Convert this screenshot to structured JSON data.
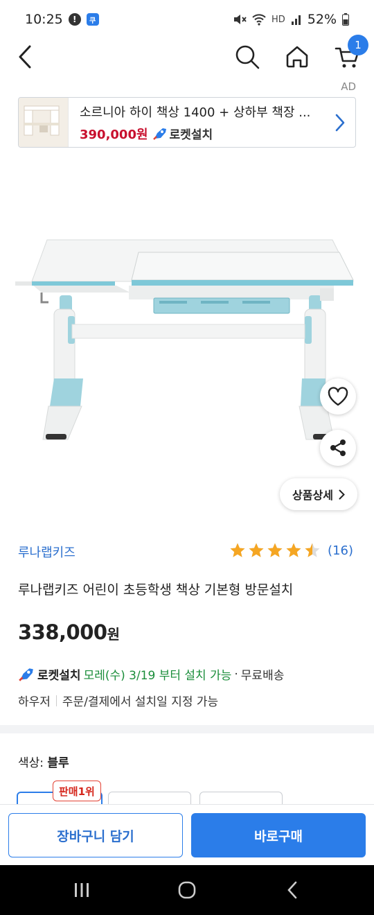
{
  "status_bar": {
    "time": "10:25",
    "notif_badge": "!",
    "app_badge": "쿠",
    "network": "HD",
    "battery": "52%"
  },
  "header": {
    "cart_count": "1"
  },
  "ad": {
    "label": "AD",
    "title": "소르니아 하이 책상 1400 + 상하부 책장 ...",
    "price": "390,000원",
    "badge": "로켓설치"
  },
  "hero": {
    "detail_label": "상품상세"
  },
  "product": {
    "brand": "루나랩키즈",
    "rating": 4.5,
    "review_count": "(16)",
    "title": "루나랩키즈 어린이 초등학생 책상 기본형 방문설치",
    "price_number": "338,000",
    "price_unit": "원"
  },
  "delivery": {
    "badge": "로켓설치",
    "schedule": "모레(수) 3/19 부터 설치 가능",
    "dot": "·",
    "free_shipping": "무료배송",
    "shipper": "하우저",
    "note": "주문/결제에서 설치일 지정 가능"
  },
  "options": {
    "label": "색상:",
    "selected": "블루",
    "best_badge": "판매1위"
  },
  "actions": {
    "cart": "장바구니 담기",
    "buy": "바로구매"
  },
  "colors": {
    "accent": "#2b7de9",
    "price_red": "#c8102e",
    "green": "#1a8d3a",
    "star": "#f5a623",
    "desk_blue": "#7ec8d8"
  }
}
